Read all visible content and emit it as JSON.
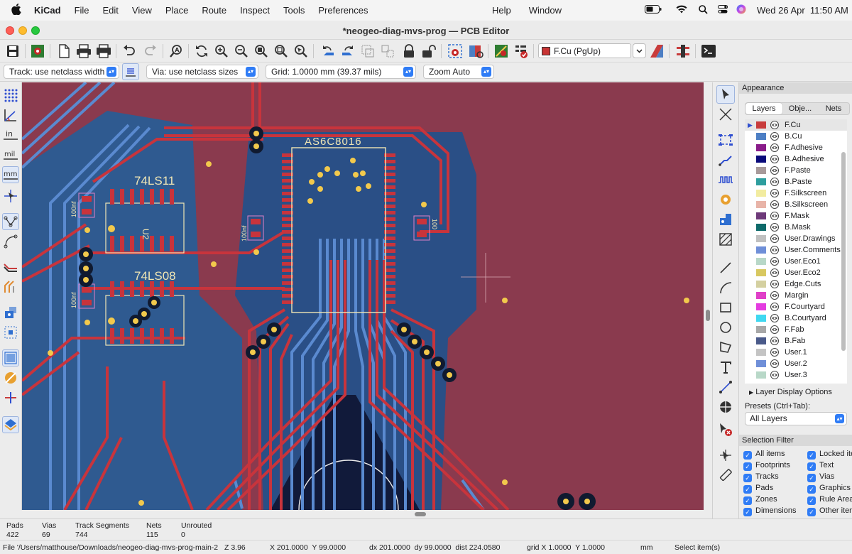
{
  "menubar": {
    "app": "KiCad",
    "items": [
      "File",
      "Edit",
      "View",
      "Place",
      "Route",
      "Inspect",
      "Tools",
      "Preferences"
    ],
    "right_items": [
      "Help",
      "Window"
    ],
    "clock": "Wed 26 Apr  11:50 AM"
  },
  "window": {
    "title": "*neogeo-diag-mvs-prog — PCB Editor"
  },
  "toolbar": {
    "layer_selector": "F.Cu (PgUp)"
  },
  "options_bar": {
    "track_width": "Track: use netclass width",
    "via_size": "Via: use netclass sizes",
    "grid": "Grid: 1.0000 mm (39.37 mils)",
    "zoom": "Zoom Auto"
  },
  "canvas": {
    "silkscreen": {
      "chip_main": "AS6C8016",
      "chip_u1": "74LS11",
      "chip_u2": "74LS08",
      "ref_u2": "U2",
      "cap_label": "100nf",
      "cap_label_right": "100"
    },
    "colors": {
      "board": "#8a3a4e",
      "front_copper": "#c8343c",
      "back_copper": "#5a8ad0",
      "silkscreen": "#f0e6b4",
      "pad_hole": "#f2c94c"
    }
  },
  "appearance": {
    "title": "Appearance",
    "tabs": [
      "Layers",
      "Obje...",
      "Nets"
    ],
    "active_tab": "Layers",
    "layers": [
      {
        "name": "F.Cu",
        "color": "#c83c3c"
      },
      {
        "name": "B.Cu",
        "color": "#4d7fc4"
      },
      {
        "name": "F.Adhesive",
        "color": "#8a1c8a"
      },
      {
        "name": "B.Adhesive",
        "color": "#0a0a7a"
      },
      {
        "name": "F.Paste",
        "color": "#a89a9a"
      },
      {
        "name": "B.Paste",
        "color": "#2e9e9e"
      },
      {
        "name": "F.Silkscreen",
        "color": "#f2eca0"
      },
      {
        "name": "B.Silkscreen",
        "color": "#e8b4a8"
      },
      {
        "name": "F.Mask",
        "color": "#6e3a7a"
      },
      {
        "name": "B.Mask",
        "color": "#0e6a6a"
      },
      {
        "name": "User.Drawings",
        "color": "#c0c0c0"
      },
      {
        "name": "User.Comments",
        "color": "#6f8fd8"
      },
      {
        "name": "User.Eco1",
        "color": "#b8d8c8"
      },
      {
        "name": "User.Eco2",
        "color": "#d8c860"
      },
      {
        "name": "Edge.Cuts",
        "color": "#d4d0a0"
      },
      {
        "name": "Margin",
        "color": "#e040c8"
      },
      {
        "name": "F.Courtyard",
        "color": "#e43ce0"
      },
      {
        "name": "B.Courtyard",
        "color": "#40d8f0"
      },
      {
        "name": "F.Fab",
        "color": "#a8a8a8"
      },
      {
        "name": "B.Fab",
        "color": "#4a5a8a"
      },
      {
        "name": "User.1",
        "color": "#c4c4c4"
      },
      {
        "name": "User.2",
        "color": "#6f8fd8"
      },
      {
        "name": "User.3",
        "color": "#b8d8c8"
      }
    ],
    "layer_display_options": "Layer Display Options",
    "presets_label": "Presets (Ctrl+Tab):",
    "presets_value": "All Layers"
  },
  "selection_filter": {
    "title": "Selection Filter",
    "left": [
      "All items",
      "Footprints",
      "Tracks",
      "Pads",
      "Zones",
      "Dimensions"
    ],
    "right": [
      "Locked items",
      "Text",
      "Vias",
      "Graphics",
      "Rule Areas",
      "Other items"
    ]
  },
  "message_panel": {
    "pads_label": "Pads",
    "pads_value": "422",
    "vias_label": "Vias",
    "vias_value": "69",
    "tracks_label": "Track Segments",
    "tracks_value": "744",
    "nets_label": "Nets",
    "nets_value": "115",
    "unrouted_label": "Unrouted",
    "unrouted_value": "0"
  },
  "status_bar": {
    "file": "File '/Users/matthouse/Downloads/neogeo-diag-mvs-prog-main-2",
    "zoom": "Z 3.96",
    "cursor": "X 201.0000  Y 99.0000",
    "delta": "dx 201.0000  dy 99.0000  dist 224.0580",
    "grid": "grid X 1.0000  Y 1.0000",
    "units": "mm",
    "hint": "Select item(s)"
  }
}
